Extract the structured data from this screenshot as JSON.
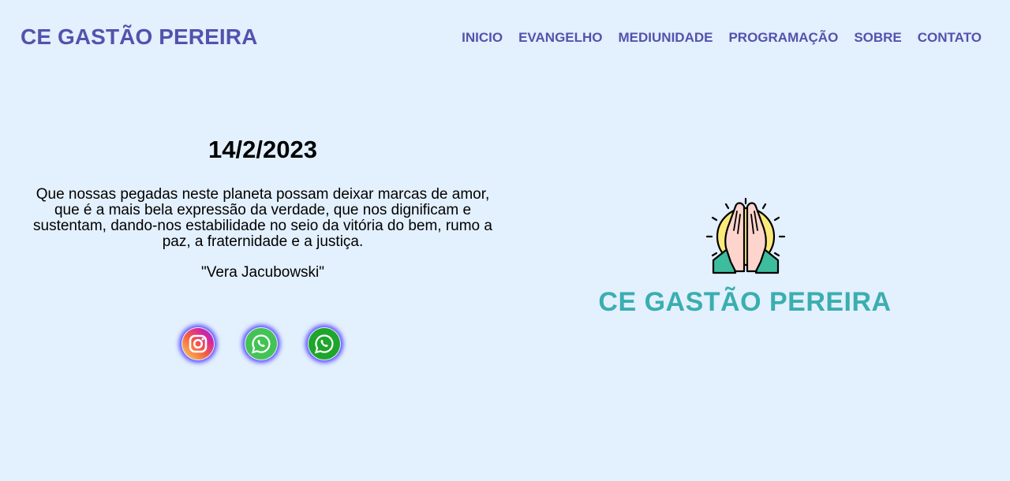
{
  "header": {
    "brand": "CE GASTÃO PEREIRA",
    "nav": [
      "INICIO",
      "EVANGELHO",
      "MEDIUNIDADE",
      "PROGRAMAÇÃO",
      "SOBRE",
      "CONTATO"
    ]
  },
  "main": {
    "date": "14/2/2023",
    "quote": "Que nossas pegadas neste planeta possam deixar marcas de amor, que é a mais bela expressão da verdade, que nos dignificam e sustentam, dando-nos estabilidade no seio da vitória do bem, rumo a paz, a fraternidade e a justiça.",
    "author": "\"Vera Jacubowski\""
  },
  "social": {
    "icons": [
      "instagram-icon",
      "whatsapp-icon",
      "whatsapp-icon"
    ]
  },
  "logo": {
    "text": "CE GASTÃO PEREIRA",
    "icon": "praying-hands-icon"
  },
  "colors": {
    "background": "#e3f0fd",
    "brand": "#5452ad",
    "logo_text": "#3aaeb0",
    "glow": "#5b4cff"
  }
}
